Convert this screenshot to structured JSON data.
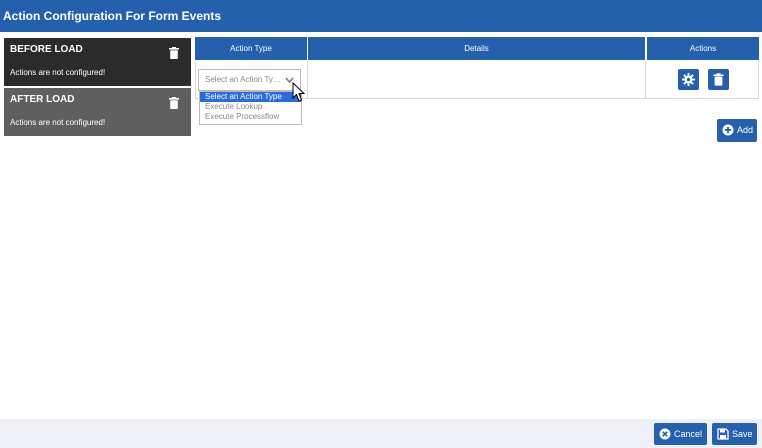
{
  "title": "Action Configuration For Form Events",
  "events": [
    {
      "name": "BEFORE LOAD",
      "status": "Actions are not configured!"
    },
    {
      "name": "AFTER LOAD",
      "status": "Actions are not configured!"
    }
  ],
  "table": {
    "columns": [
      "Action Type",
      "Details",
      "Actions"
    ],
    "row": {
      "select_display": "Select an Action Ty…",
      "options": [
        "Select an Action Type",
        "Execute Lookup",
        "Execute Processflow"
      ],
      "selected_option": "Select an Action Type"
    }
  },
  "buttons": {
    "add": "Add",
    "cancel": "Cancel",
    "save": "Save"
  },
  "colors": {
    "primary": "#2460ac",
    "before_load_bg": "#2b2b2b",
    "after_load_bg": "#5f5f5f",
    "footer_bg": "#eef0f6"
  },
  "icons": [
    "trash-icon",
    "gear-icon",
    "plus-circle-icon",
    "close-circle-icon",
    "save-icon",
    "chevron-down-icon",
    "mouse-cursor-icon"
  ]
}
